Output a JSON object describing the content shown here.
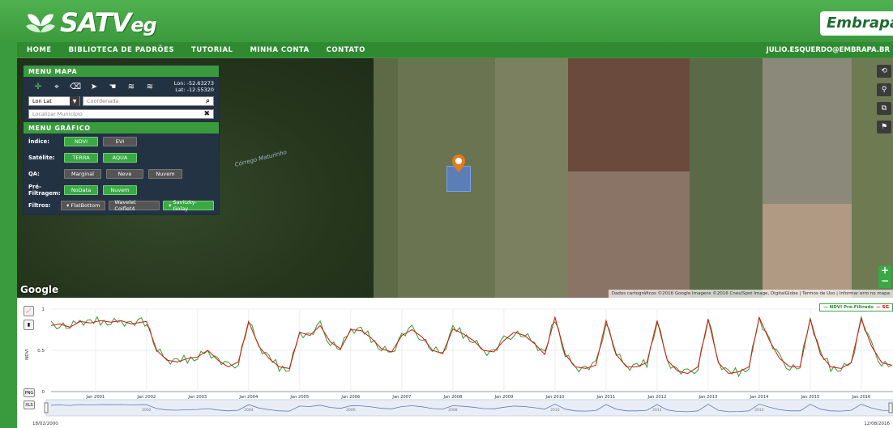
{
  "brand": {
    "logo_text": "SATVeg",
    "logo_main": "SATV",
    "logo_small": "eg",
    "partner": "Embrapa"
  },
  "nav": {
    "items": [
      "HOME",
      "BIBLIOTECA DE PADRÕES",
      "TUTORIAL",
      "MINHA CONTA",
      "CONTATO"
    ],
    "user": "JULIO.ESQUERDO@EMBRAPA.BR"
  },
  "map": {
    "river_label": "Córrego Maturinho",
    "google": "Google",
    "attribution": "Dados cartográficos ©2016 Google Imagens ©2016 Cnes/Spot Image, DigitalGlobe | Termos de Uso | Informar erro no mapa"
  },
  "menu_mapa": {
    "title": "MENU MAPA",
    "lon": "Lon: -52.63273",
    "lat": "Lat: -12.55320",
    "select_value": "Lon Lat",
    "coord_placeholder": "Coordenada",
    "municipio_placeholder": "Localizar Município"
  },
  "menu_grafico": {
    "title": "MENU GRÁFICO",
    "indice": {
      "label": "Índice:",
      "options": [
        "NDVI",
        "EVI"
      ]
    },
    "satelite": {
      "label": "Satélite:",
      "options": [
        "TERRA",
        "AQUA"
      ]
    },
    "qa": {
      "label": "QA:",
      "options": [
        "Marginal",
        "Neve",
        "Nuvem"
      ]
    },
    "pre": {
      "label": "Pré-Filtragem:",
      "options": [
        "NoData",
        "Nuvem"
      ]
    },
    "filtros": {
      "label": "Filtros:",
      "options": [
        "FlatBottom",
        "Wavelet Coiflet4",
        "Savitzky-Golay"
      ]
    }
  },
  "chart_export": {
    "png": "PNG",
    "xls": "XLS"
  },
  "chart_data": {
    "type": "line",
    "ylabel": "NDVI",
    "ylim": [
      0,
      1
    ],
    "yticks": [
      "0",
      "0.5",
      "1"
    ],
    "xticks": [
      "Jan 2001",
      "Jan 2002",
      "Jan 2003",
      "Jan 2004",
      "Jan 2005",
      "Jan 2006",
      "Jan 2007",
      "Jan 2008",
      "Jan 2009",
      "Jan 2010",
      "Jan 2011",
      "Jan 2012",
      "Jan 2013",
      "Jan 2014",
      "Jan 2015",
      "Jan 2016"
    ],
    "navigator_ticks": [
      "2002",
      "2004",
      "2006",
      "2008",
      "2010",
      "2012",
      "2014"
    ],
    "x_start": "18/02/2000",
    "x_end": "12/08/2016",
    "series": [
      {
        "name": "NDVI Pré-Filtrado",
        "color": "#2e9e2e"
      },
      {
        "name": "SG",
        "color": "#d11"
      }
    ],
    "x": [
      2000.13,
      2000.3,
      2000.5,
      2000.7,
      2000.9,
      2001.1,
      2001.3,
      2001.5,
      2001.7,
      2001.9,
      2002.0,
      2002.2,
      2002.4,
      2002.6,
      2002.8,
      2003.0,
      2003.2,
      2003.4,
      2003.6,
      2003.8,
      2004.0,
      2004.2,
      2004.4,
      2004.6,
      2004.8,
      2005.0,
      2005.2,
      2005.4,
      2005.6,
      2005.8,
      2006.0,
      2006.2,
      2006.4,
      2006.6,
      2006.8,
      2007.0,
      2007.2,
      2007.4,
      2007.6,
      2007.8,
      2008.0,
      2008.2,
      2008.4,
      2008.6,
      2008.8,
      2009.0,
      2009.2,
      2009.4,
      2009.6,
      2009.8,
      2010.0,
      2010.2,
      2010.4,
      2010.6,
      2010.8,
      2011.0,
      2011.2,
      2011.4,
      2011.6,
      2011.8,
      2012.0,
      2012.2,
      2012.4,
      2012.6,
      2012.8,
      2013.0,
      2013.2,
      2013.4,
      2013.6,
      2013.8,
      2014.0,
      2014.2,
      2014.4,
      2014.6,
      2014.8,
      2015.0,
      2015.2,
      2015.4,
      2015.6,
      2015.8,
      2016.0,
      2016.2,
      2016.4,
      2016.6
    ],
    "values": [
      0.8,
      0.82,
      0.78,
      0.85,
      0.83,
      0.86,
      0.84,
      0.86,
      0.82,
      0.84,
      0.85,
      0.5,
      0.38,
      0.36,
      0.4,
      0.42,
      0.5,
      0.38,
      0.3,
      0.36,
      0.85,
      0.55,
      0.4,
      0.3,
      0.28,
      0.72,
      0.68,
      0.8,
      0.6,
      0.52,
      0.75,
      0.74,
      0.65,
      0.52,
      0.48,
      0.68,
      0.75,
      0.66,
      0.5,
      0.46,
      0.76,
      0.7,
      0.62,
      0.5,
      0.48,
      0.62,
      0.72,
      0.68,
      0.58,
      0.45,
      0.9,
      0.45,
      0.3,
      0.28,
      0.32,
      0.86,
      0.45,
      0.3,
      0.3,
      0.35,
      0.86,
      0.38,
      0.25,
      0.22,
      0.3,
      0.88,
      0.35,
      0.22,
      0.24,
      0.3,
      0.9,
      0.62,
      0.4,
      0.3,
      0.3,
      0.88,
      0.45,
      0.3,
      0.28,
      0.35,
      0.88,
      0.55,
      0.35,
      0.32
    ],
    "grid": true,
    "legend_position": "top-right"
  }
}
